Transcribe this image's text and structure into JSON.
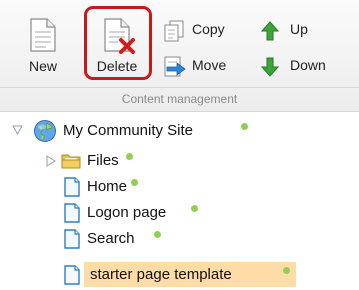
{
  "ribbon": {
    "new_label": "New",
    "delete_label": "Delete",
    "copy_label": "Copy",
    "move_label": "Move",
    "up_label": "Up",
    "down_label": "Down",
    "group_label": "Content management",
    "highlight_color": "#c41a1a"
  },
  "tree": {
    "root": {
      "label": "My Community Site",
      "icon": "globe-icon",
      "expanded": true
    },
    "children": [
      {
        "label": "Files",
        "icon": "folder-icon",
        "collapsed": true
      },
      {
        "label": "Home",
        "icon": "page-icon"
      },
      {
        "label": "Logon page",
        "icon": "page-icon"
      },
      {
        "label": "Search",
        "icon": "page-icon"
      },
      {
        "label": "starter page template",
        "icon": "page-icon",
        "selected": true
      }
    ],
    "status_color": "#8fd14f",
    "selected_color": "#fddca7"
  }
}
